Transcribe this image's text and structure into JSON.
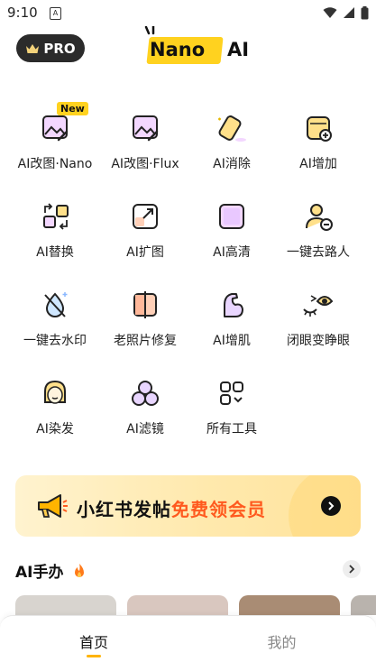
{
  "status_bar": {
    "time": "9:10",
    "notification_glyph": "A"
  },
  "header": {
    "pro_label": "PRO",
    "logo_word": "Nano",
    "logo_ai": "AI"
  },
  "tools": [
    {
      "label": "AI改图·Nano",
      "icon": "image-edit-icon",
      "badge": "New"
    },
    {
      "label": "AI改图·Flux",
      "icon": "image-edit-icon"
    },
    {
      "label": "AI消除",
      "icon": "eraser-icon"
    },
    {
      "label": "AI增加",
      "icon": "add-layer-icon"
    },
    {
      "label": "AI替换",
      "icon": "swap-icon"
    },
    {
      "label": "AI扩图",
      "icon": "expand-icon"
    },
    {
      "label": "AI高清",
      "icon": "hd-icon"
    },
    {
      "label": "一键去路人",
      "icon": "remove-person-icon"
    },
    {
      "label": "一键去水印",
      "icon": "watermark-remove-icon"
    },
    {
      "label": "老照片修复",
      "icon": "photo-restore-icon"
    },
    {
      "label": "AI增肌",
      "icon": "muscle-icon"
    },
    {
      "label": "闭眼变睁眼",
      "icon": "eye-open-icon"
    },
    {
      "label": "AI染发",
      "icon": "hair-dye-icon"
    },
    {
      "label": "AI滤镜",
      "icon": "filter-icon"
    },
    {
      "label": "所有工具",
      "icon": "all-tools-icon"
    }
  ],
  "banner": {
    "text_main": "小红书发帖",
    "text_highlight": "免费领会员"
  },
  "section": {
    "title": "AI手办"
  },
  "nav": {
    "home": "首页",
    "mine": "我的"
  },
  "colors": {
    "accent": "#ffd21f",
    "highlight": "#ff5a1f",
    "icon_fill": "#f3d7ff"
  }
}
